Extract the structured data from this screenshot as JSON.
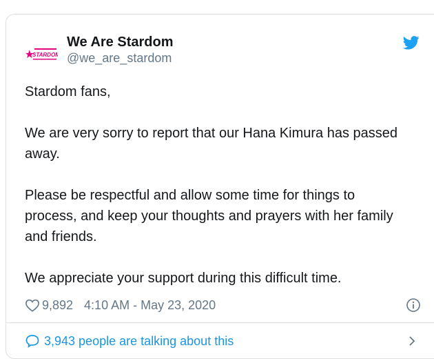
{
  "tweet": {
    "display_name": "We Are Stardom",
    "handle": "@we_are_stardom",
    "paragraphs": [
      "Stardom fans,",
      "We are very sorry to report that our Hana Kimura has passed away.",
      "Please be respectful and allow some time for things to process, and keep your thoughts and prayers with her family and friends.",
      "We appreciate your support during this difficult time."
    ],
    "likes": "9,892",
    "timestamp": "4:10 AM - May 23, 2020",
    "talking": "3,943 people are talking about this"
  },
  "avatar": {
    "logo_text": "STARDOM",
    "colors": {
      "primary": "#e5007f"
    }
  },
  "icons": {
    "bird": "twitter-bird-icon",
    "like": "heart-icon",
    "info": "info-icon",
    "reply": "speech-bubble-icon",
    "chevron": "chevron-right-icon"
  },
  "colors": {
    "text": "#14171a",
    "secondary": "#657786",
    "link": "#1b95e0",
    "twitter_blue": "#1da1f2",
    "border": "#dcdfe2"
  }
}
